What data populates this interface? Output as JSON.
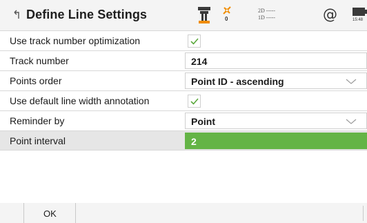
{
  "header": {
    "title": "Define Line Settings",
    "satellite_count": "0",
    "precision_2d": "2D -----",
    "precision_1d": "1D -----",
    "at_symbol": "@",
    "clock": "15:48"
  },
  "settings": [
    {
      "label": "Use track number optimization",
      "type": "checkbox",
      "checked": true
    },
    {
      "label": "Track number",
      "type": "input",
      "value": "214"
    },
    {
      "label": "Points order",
      "type": "dropdown",
      "value": "Point ID - ascending"
    },
    {
      "label": "Use default line width annotation",
      "type": "checkbox",
      "checked": true
    },
    {
      "label": "Reminder by",
      "type": "dropdown",
      "value": "Point"
    },
    {
      "label": "Point interval",
      "type": "input",
      "value": "2",
      "active": true
    }
  ],
  "footer": {
    "ok_label": "OK"
  },
  "colors": {
    "accent_green": "#64b446",
    "check_green": "#5aa83c",
    "rover_orange": "#f08c00"
  },
  "icons": [
    "back-icon",
    "rover-icon",
    "satellite-icon",
    "at-icon",
    "battery-icon",
    "check-icon",
    "chevron-down-icon"
  ]
}
